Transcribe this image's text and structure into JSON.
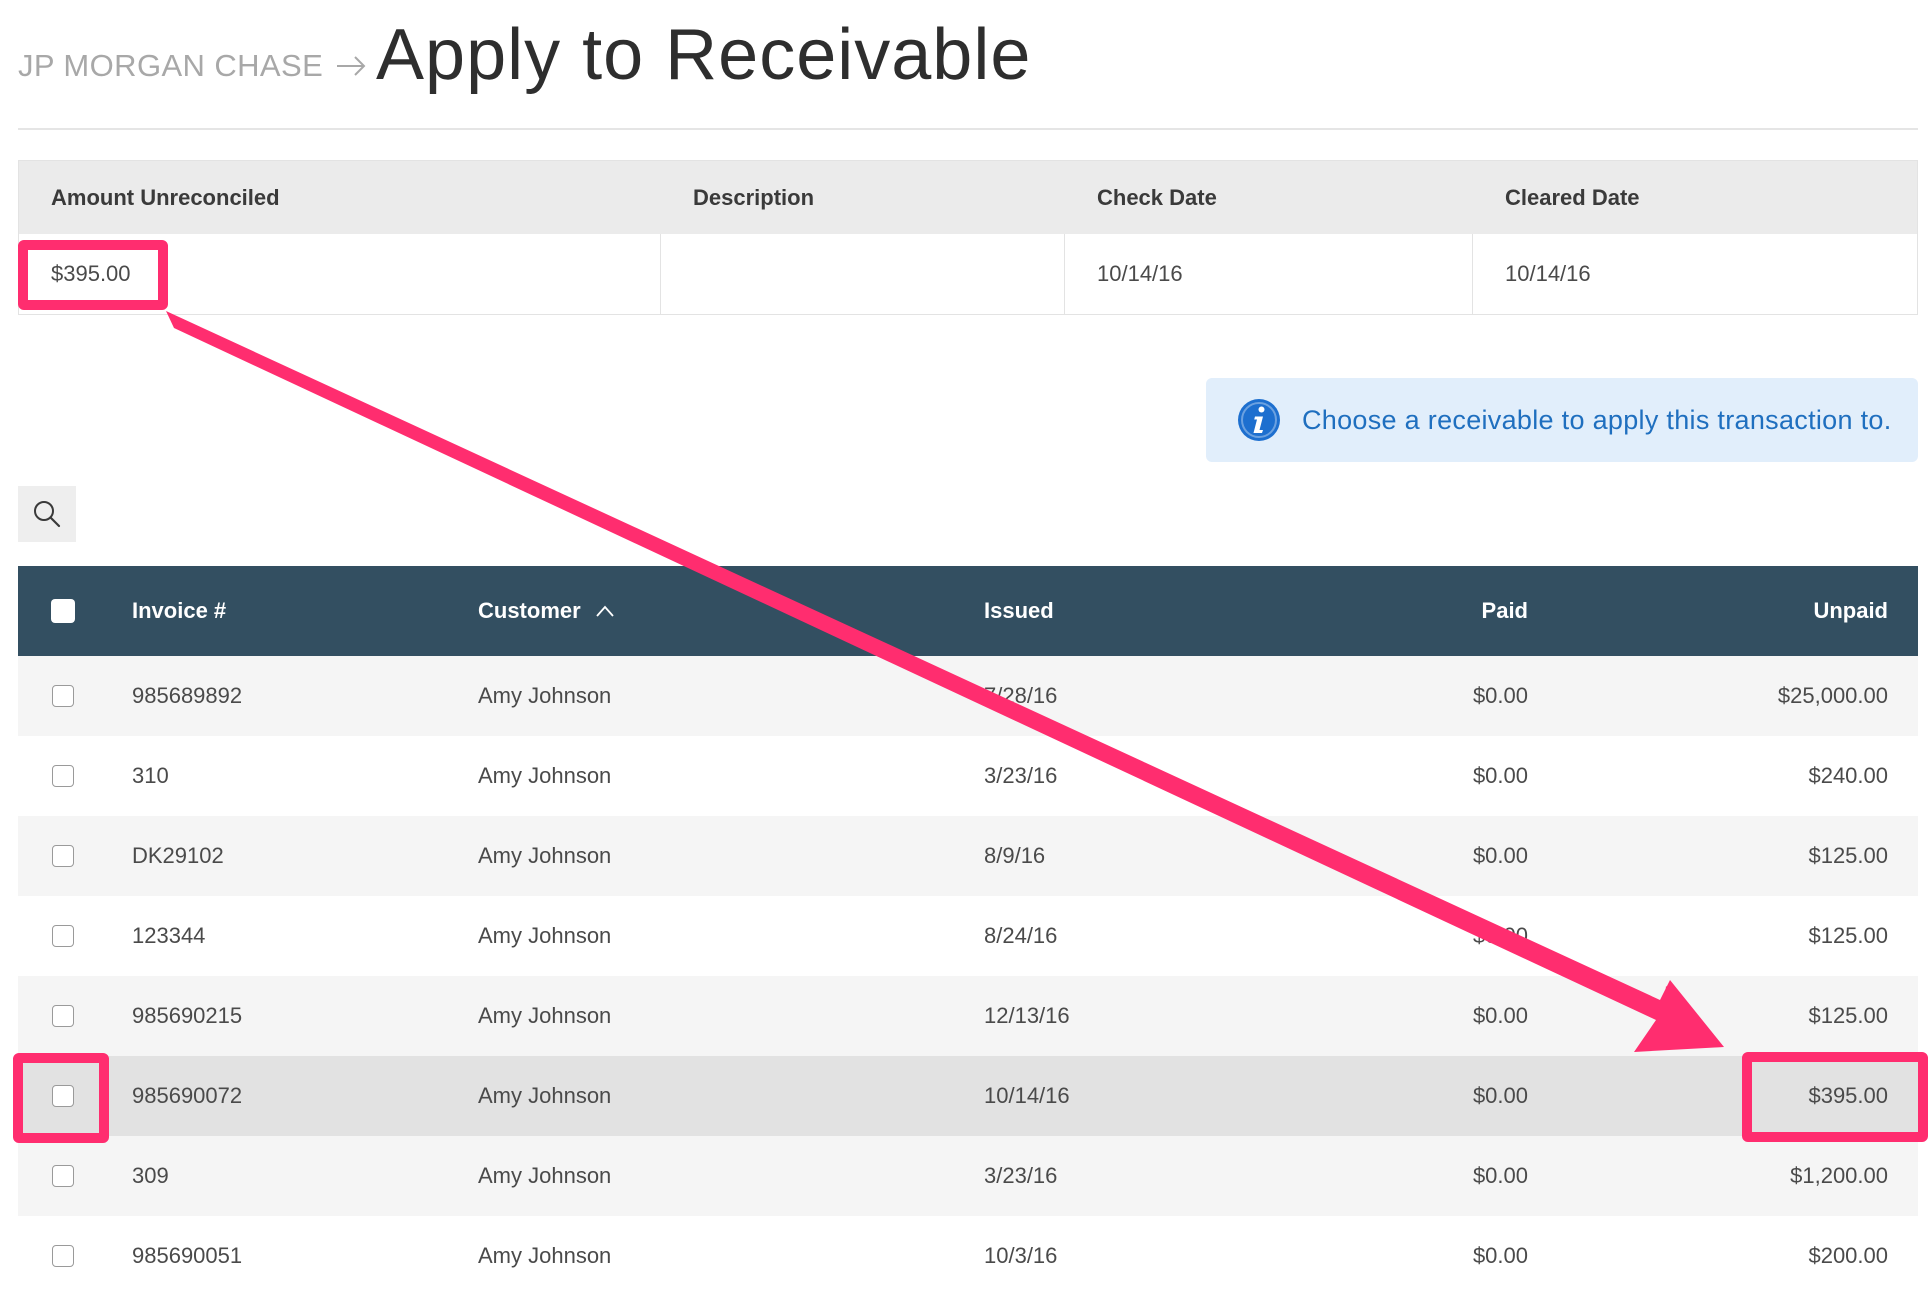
{
  "header": {
    "breadcrumb": "JP MORGAN CHASE",
    "title": "Apply to Receivable"
  },
  "transaction": {
    "headers": [
      "Amount Unreconciled",
      "Description",
      "Check Date",
      "Cleared Date"
    ],
    "amount_unreconciled": "$395.00",
    "description": "",
    "check_date": "10/14/16",
    "cleared_date": "10/14/16"
  },
  "info_banner": {
    "message": "Choose a receivable to apply this transaction to."
  },
  "grid": {
    "headers": {
      "invoice": "Invoice #",
      "customer": "Customer",
      "issued": "Issued",
      "paid": "Paid",
      "unpaid": "Unpaid"
    },
    "sort": {
      "column": "customer",
      "direction": "ascending"
    },
    "rows": [
      {
        "invoice": "985689892",
        "customer": "Amy Johnson",
        "issued": "7/28/16",
        "paid": "$0.00",
        "unpaid": "$25,000.00"
      },
      {
        "invoice": "310",
        "customer": "Amy Johnson",
        "issued": "3/23/16",
        "paid": "$0.00",
        "unpaid": "$240.00"
      },
      {
        "invoice": "DK29102",
        "customer": "Amy Johnson",
        "issued": "8/9/16",
        "paid": "$0.00",
        "unpaid": "$125.00"
      },
      {
        "invoice": "123344",
        "customer": "Amy Johnson",
        "issued": "8/24/16",
        "paid": "$0.00",
        "unpaid": "$125.00"
      },
      {
        "invoice": "985690215",
        "customer": "Amy Johnson",
        "issued": "12/13/16",
        "paid": "$0.00",
        "unpaid": "$125.00"
      },
      {
        "invoice": "985690072",
        "customer": "Amy Johnson",
        "issued": "10/14/16",
        "paid": "$0.00",
        "unpaid": "$395.00"
      },
      {
        "invoice": "309",
        "customer": "Amy Johnson",
        "issued": "3/23/16",
        "paid": "$0.00",
        "unpaid": "$1,200.00"
      },
      {
        "invoice": "985690051",
        "customer": "Amy Johnson",
        "issued": "10/3/16",
        "paid": "$0.00",
        "unpaid": "$200.00"
      }
    ]
  },
  "icons": {
    "breadcrumb_separator": "arrow-right-icon",
    "info": "info-icon",
    "search": "search-icon",
    "sort": "chevron-up-icon"
  },
  "colors": {
    "grid_header": "#334f61",
    "annotation": "#ff2d6f",
    "info_text": "#1f6fbf",
    "info_background": "#e1eefb"
  }
}
